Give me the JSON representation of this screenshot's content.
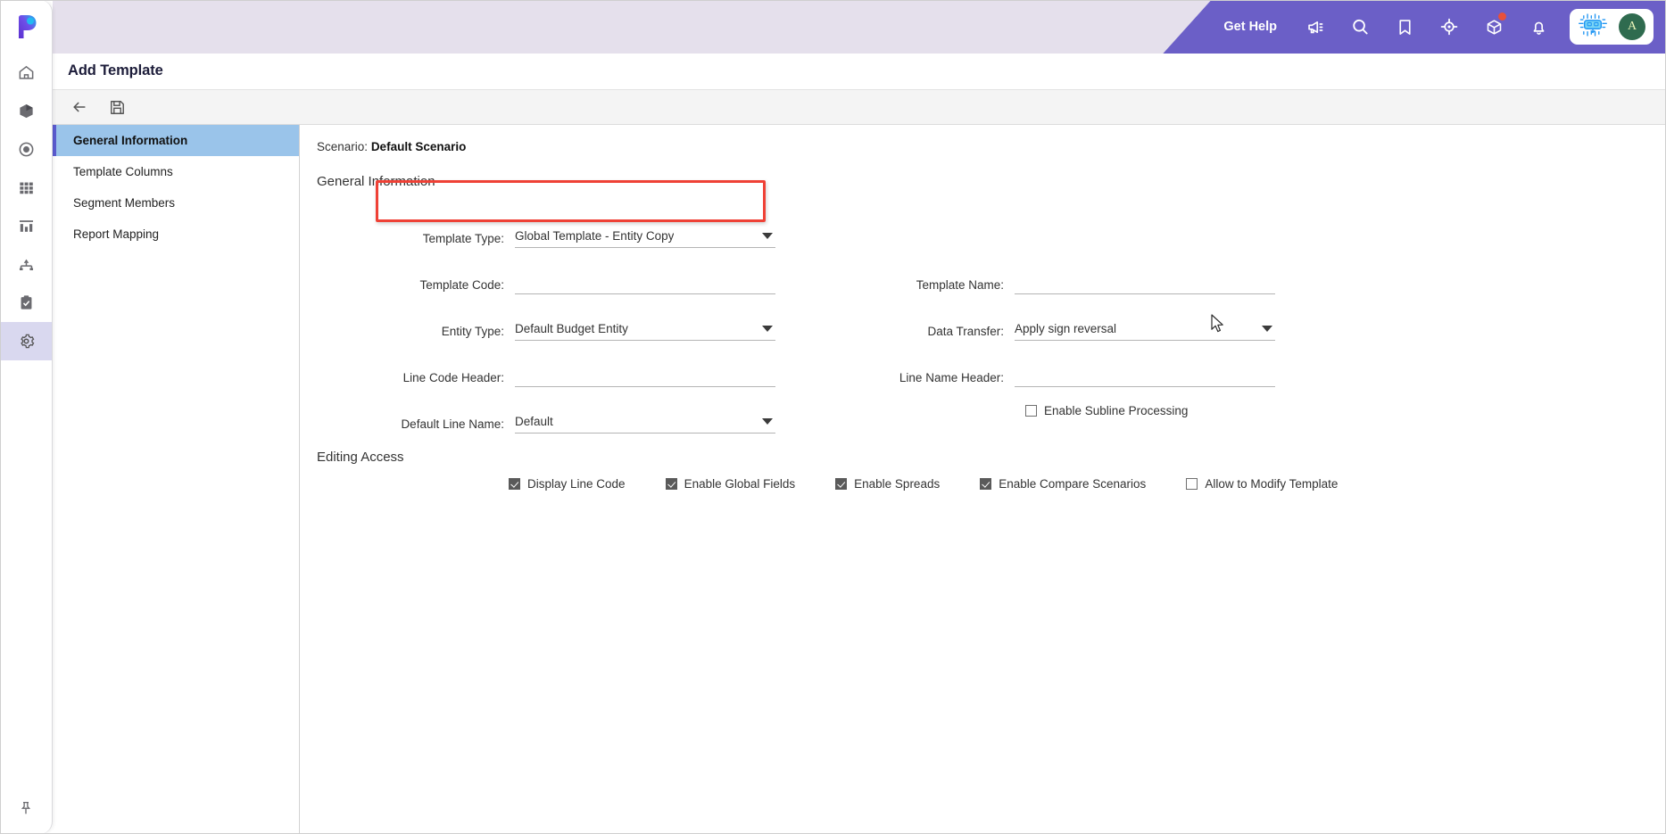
{
  "app": {
    "logo_letter": "p",
    "rail_icons": [
      {
        "name": "home-icon",
        "label": "Home"
      },
      {
        "name": "cube-icon",
        "label": "Models"
      },
      {
        "name": "target-icon",
        "label": "Focus"
      },
      {
        "name": "grid-icon",
        "label": "Grid"
      },
      {
        "name": "bar-chart-icon",
        "label": "Reports"
      },
      {
        "name": "hierarchy-icon",
        "label": "Hierarchy"
      },
      {
        "name": "clipboard-check-icon",
        "label": "Tasks"
      },
      {
        "name": "gear-icon",
        "label": "Settings"
      }
    ],
    "rail_active_index": 7,
    "pin_icon": "pin-icon"
  },
  "header": {
    "get_help": "Get Help",
    "icons": [
      {
        "name": "announcement-icon"
      },
      {
        "name": "search-icon"
      },
      {
        "name": "bookmark-icon"
      },
      {
        "name": "target-crosshair-icon"
      },
      {
        "name": "package-icon",
        "badge": true
      },
      {
        "name": "bell-icon"
      }
    ],
    "ai_icon": "ai-chip-icon",
    "avatar_initial": "A",
    "purple": "#6b5fc7",
    "lavender": "#e5e0ec"
  },
  "page": {
    "title": "Add Template"
  },
  "toolbar": {
    "back_label": "Back",
    "save_label": "Save",
    "back_icon": "arrow-left-icon",
    "save_icon": "save-disk-icon"
  },
  "nav": {
    "items": [
      {
        "label": "General Information",
        "active": true
      },
      {
        "label": "Template Columns",
        "active": false
      },
      {
        "label": "Segment Members",
        "active": false
      },
      {
        "label": "Report Mapping",
        "active": false
      }
    ]
  },
  "form": {
    "scenario_label": "Scenario:",
    "scenario_value": "Default Scenario",
    "section_title": "General Information",
    "left_fields": [
      {
        "label": "Template Type:",
        "value": "Global Template - Entity Copy",
        "type": "select",
        "highlighted": true
      },
      {
        "label": "Template Code:",
        "value": "",
        "type": "text",
        "placeholder": ""
      },
      {
        "label": "Entity Type:",
        "value": "Default Budget Entity",
        "type": "select"
      },
      {
        "label": "Line Code Header:",
        "value": "",
        "type": "text",
        "placeholder": ""
      },
      {
        "label": "Default Line Name:",
        "value": "Default",
        "type": "select"
      }
    ],
    "right_fields": [
      {
        "label": "",
        "value": "",
        "type": "spacer"
      },
      {
        "label": "Template Name:",
        "value": "",
        "type": "text",
        "placeholder": ""
      },
      {
        "label": "Data Transfer:",
        "value": "Apply sign reversal",
        "type": "select"
      },
      {
        "label": "Line Name Header:",
        "value": "",
        "type": "text",
        "placeholder": ""
      },
      {
        "label": "Enable Subline Processing",
        "value": "",
        "type": "checkbox",
        "checked": false
      }
    ],
    "editing_access_title": "Editing Access",
    "access_checkboxes": [
      {
        "label": "Display Line Code",
        "checked": true
      },
      {
        "label": "Enable Global Fields",
        "checked": true
      },
      {
        "label": "Enable Spreads",
        "checked": true
      },
      {
        "label": "Enable Compare Scenarios",
        "checked": true
      },
      {
        "label": "Allow to Modify Template",
        "checked": false
      }
    ]
  },
  "annotation": {
    "highlight_color": "#ef4136",
    "highlight_target": "Template Type field"
  }
}
